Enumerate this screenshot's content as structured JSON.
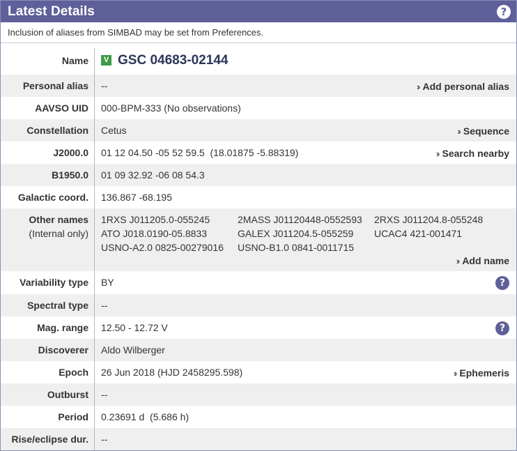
{
  "header": {
    "title": "Latest Details",
    "help": "?"
  },
  "note": "Inclusion of aliases from SIMBAD may be set from Preferences.",
  "name": {
    "label": "Name",
    "badge": "V",
    "value": "GSC 04683-02144"
  },
  "personal_alias": {
    "label": "Personal alias",
    "value": "--",
    "action": "Add personal alias"
  },
  "uid": {
    "label": "AAVSO UID",
    "value": "000-BPM-333 (No observations)"
  },
  "constellation": {
    "label": "Constellation",
    "value": "Cetus",
    "action": "Sequence"
  },
  "j2000": {
    "label": "J2000.0",
    "value": "01 12 04.50 -05 52 59.5  (18.01875 -5.88319)",
    "action": "Search nearby"
  },
  "b1950": {
    "label": "B1950.0",
    "value": "01 09 32.92 -06 08 54.3"
  },
  "galactic": {
    "label": "Galactic coord.",
    "value": "136.867 -68.195"
  },
  "other_names": {
    "label": "Other names",
    "sublabel": "(Internal only)",
    "names": [
      "1RXS J011205.0-055245",
      "2MASS J01120448-0552593",
      "2RXS J011204.8-055248",
      "ATO J018.0190-05.8833",
      "GALEX J011204.5-055259",
      "UCAC4 421-001471",
      "USNO-A2.0 0825-00279016",
      "USNO-B1.0 0841-0011715"
    ],
    "action": "Add name"
  },
  "variability": {
    "label": "Variability type",
    "value": "BY",
    "help": "?"
  },
  "spectral": {
    "label": "Spectral type",
    "value": "--"
  },
  "mag_range": {
    "label": "Mag. range",
    "value": "12.50 - 12.72 V",
    "help": "?"
  },
  "discoverer": {
    "label": "Discoverer",
    "value": "Aldo Wilberger"
  },
  "epoch": {
    "label": "Epoch",
    "value": "26 Jun 2018 (HJD 2458295.598)",
    "action": "Ephemeris"
  },
  "outburst": {
    "label": "Outburst",
    "value": "--"
  },
  "period": {
    "label": "Period",
    "value": "0.23691 d  (5.686 h)"
  },
  "rise": {
    "label": "Rise/eclipse dur.",
    "value": "--"
  },
  "colors": {
    "header_bg": "#5f5f9a",
    "badge_green": "#3d9b4a",
    "name_color": "#2c3659"
  },
  "icons": {
    "action": "double-chevron-right-icon",
    "help": "question-circle-icon"
  }
}
